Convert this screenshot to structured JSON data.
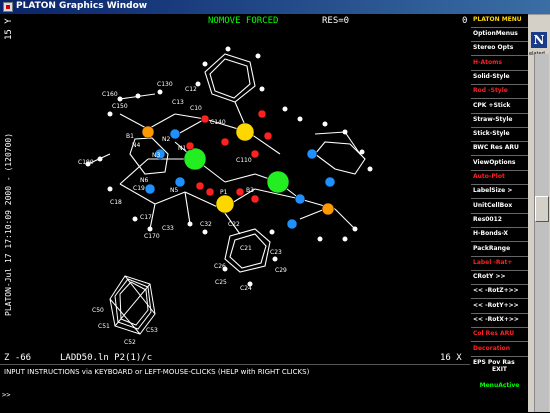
{
  "window": {
    "title": "PLATON Graphics Window"
  },
  "canvas": {
    "header_status": "NOMOVE FORCED",
    "res_label": "RES=0",
    "corner_top_right": "0",
    "left_vertical_text": "PLATON-Jul 17 17:10:09 2000 - (120700)",
    "top_left_vertical": "15 Y",
    "bottom_left": "Z -66",
    "bottom_center": "LADD50.ln P2(1)/c",
    "bottom_right": "16 X",
    "atom_labels": [
      "C160",
      "C150",
      "C130",
      "C12",
      "C13",
      "C10",
      "C14",
      "N4",
      "N1",
      "N2",
      "N3",
      "N5",
      "N6",
      "C190",
      "C19",
      "C18",
      "C140",
      "C110",
      "P1",
      "C160b",
      "B1",
      "B3",
      "C17",
      "C170",
      "C33",
      "C32",
      "C31",
      "C22",
      "C21",
      "C26",
      "C23",
      "C25",
      "C24",
      "C28",
      "C29",
      "C20",
      "C50",
      "C51",
      "C52",
      "C53"
    ]
  },
  "menu": {
    "title": "PLATON MENU",
    "items": [
      {
        "label": "OptionMenus",
        "color": "white"
      },
      {
        "label": "Stereo Opts",
        "color": "white"
      },
      {
        "label": "H-Atoms",
        "color": "red"
      },
      {
        "label": "Solid-Style",
        "color": "white",
        "bar": 0.3
      },
      {
        "label": "Rod -Style",
        "color": "red"
      },
      {
        "label": "CPK +Stick",
        "color": "white"
      },
      {
        "label": "Straw-Style",
        "color": "white"
      },
      {
        "label": "Stick-Style",
        "color": "white"
      },
      {
        "label": "BWC Res ARU",
        "color": "white"
      },
      {
        "label": "ViewOptions",
        "color": "white"
      },
      {
        "label": "Auto-Plot",
        "color": "red"
      },
      {
        "label": "LabelSize >",
        "color": "white",
        "bar": 0.35
      },
      {
        "label": "UnitCellBox",
        "color": "white"
      },
      {
        "label": "Res0012",
        "color": "white"
      },
      {
        "label": "H-Bonds-X",
        "color": "white"
      },
      {
        "label": "PackRange",
        "color": "white"
      },
      {
        "label": "Label -Rat+",
        "color": "red"
      },
      {
        "label": "CRotY >>",
        "color": "white",
        "bar": 0.2
      },
      {
        "label": "<< -RotZ+>>",
        "color": "white"
      },
      {
        "label": "<< -RotY+>>",
        "color": "white"
      },
      {
        "label": "<< -RotX+>>",
        "color": "white"
      },
      {
        "label": "Col Res ARU",
        "color": "red"
      },
      {
        "label": "Decoration",
        "color": "red"
      },
      {
        "label": "EPS Pov Ras",
        "color": "white"
      },
      {
        "label": "Reset   End",
        "color": "white"
      }
    ]
  },
  "exit": {
    "exit_label": "EXIT",
    "menu_active": "MenuActive"
  },
  "status": {
    "instructions": "INPUT INSTRUCTIONS via KEYBOARD or LEFT-MOUSE-CLICKS (HELP with RIGHT CLICKS)",
    "prompt": ">>"
  },
  "side": {
    "logo_letter": "N",
    "caption": "elated"
  },
  "colors": {
    "carbon": "#ffffff",
    "nitrogen": "#1e90ff",
    "oxygen": "#ff2020",
    "phosphorus": "#ffd700",
    "metal": "#22ee22",
    "boron": "#ff9900",
    "header": "#00ff00",
    "menu_title": "#ffd700"
  }
}
